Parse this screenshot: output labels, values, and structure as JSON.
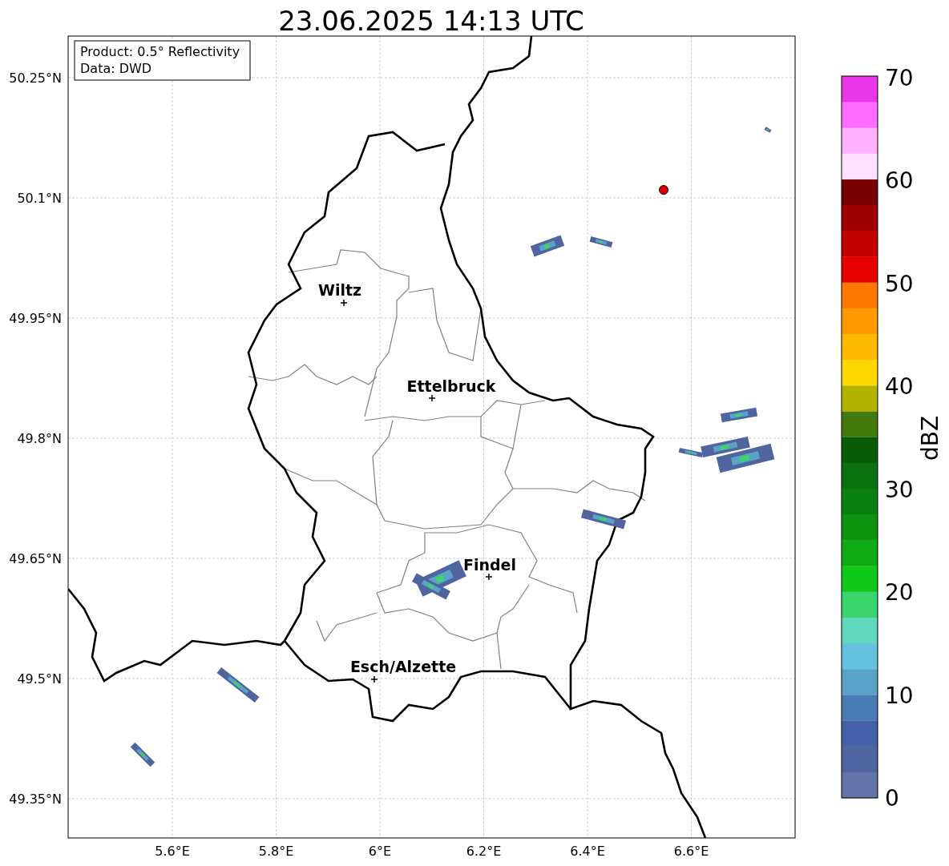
{
  "title": "23.06.2025 14:13 UTC",
  "info_box": {
    "lines": [
      "Product: 0.5° Reflectivity",
      "Data: DWD"
    ]
  },
  "lat_ticks": [
    "50.25°N",
    "50.1°N",
    "49.95°N",
    "49.8°N",
    "49.65°N",
    "49.5°N",
    "49.35°N"
  ],
  "lon_ticks": [
    "5.6°E",
    "5.8°E",
    "6°E",
    "6.2°E",
    "6.4°E",
    "6.6°E"
  ],
  "cities": [
    {
      "name": "Wiltz"
    },
    {
      "name": "Ettelbruck"
    },
    {
      "name": "Findel"
    },
    {
      "name": "Esch/Alzette"
    }
  ],
  "colorbar": {
    "label": "dBZ",
    "ticks": [
      "70",
      "60",
      "50",
      "40",
      "30",
      "20",
      "10",
      "0"
    ],
    "segments": [
      {
        "color": "#6474a8"
      },
      {
        "color": "#5064a0"
      },
      {
        "color": "#4460a8"
      },
      {
        "color": "#4a7ab4"
      },
      {
        "color": "#5aa2c8"
      },
      {
        "color": "#64c2de"
      },
      {
        "color": "#60d8c0"
      },
      {
        "color": "#3cd46c"
      },
      {
        "color": "#10c818"
      },
      {
        "color": "#10aa14"
      },
      {
        "color": "#0c9410"
      },
      {
        "color": "#0a8010"
      },
      {
        "color": "#0a7010"
      },
      {
        "color": "#085c08"
      },
      {
        "color": "#447a0a"
      },
      {
        "color": "#b2b200"
      },
      {
        "color": "#ffd800"
      },
      {
        "color": "#ffb800"
      },
      {
        "color": "#ff9a00"
      },
      {
        "color": "#ff7800"
      },
      {
        "color": "#e60000"
      },
      {
        "color": "#c20000"
      },
      {
        "color": "#9e0000"
      },
      {
        "color": "#780000"
      },
      {
        "color": "#ffe0ff"
      },
      {
        "color": "#ffb0ff"
      },
      {
        "color": "#ff6cff"
      },
      {
        "color": "#ea36ea"
      }
    ]
  }
}
